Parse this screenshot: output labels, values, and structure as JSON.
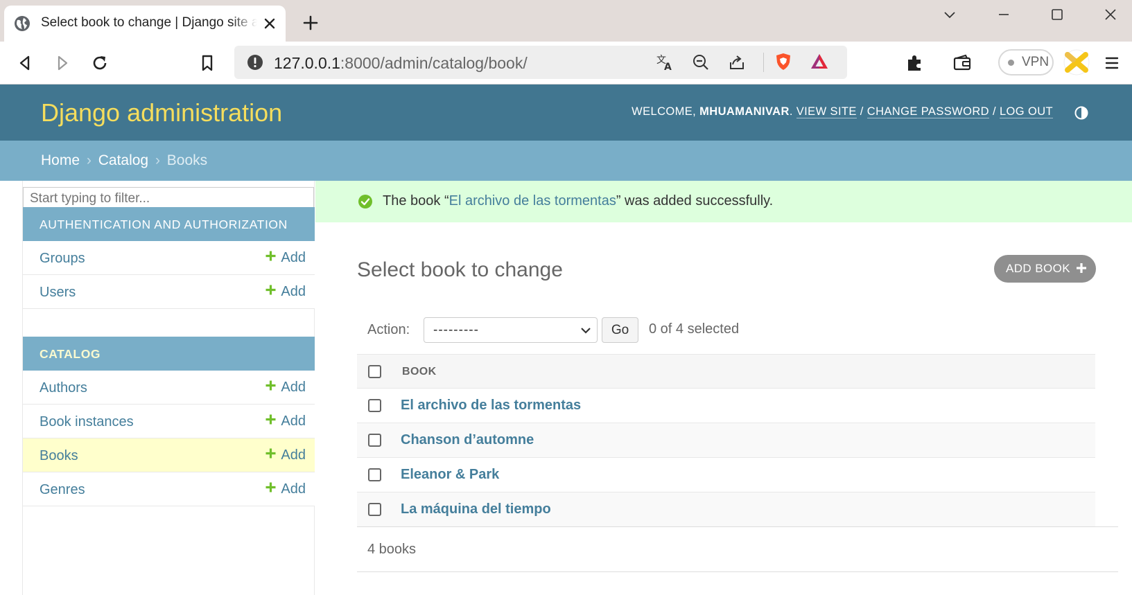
{
  "browser": {
    "tab_title": "Select book to change | Django site admin",
    "url_host": "127.0.0.1",
    "url_rest": ":8000/admin/catalog/book/",
    "vpn_label": "VPN",
    "icons": [
      "globe-icon",
      "close-icon",
      "plus-icon",
      "chevron-down-icon",
      "minimize-icon",
      "maximize-icon",
      "back-icon",
      "forward-icon",
      "reload-icon",
      "bookmark-icon",
      "info-icon",
      "translate-icon",
      "zoom-out-icon",
      "share-icon",
      "brave-shield-icon",
      "brave-rewards-icon",
      "extensions-icon",
      "wallet-icon",
      "profile-icon",
      "menu-icon"
    ]
  },
  "header": {
    "brand": "Django administration",
    "welcome": "WELCOME,",
    "username": "MHUAMANIVAR",
    "view_site": "VIEW SITE",
    "change_password": "CHANGE PASSWORD",
    "log_out": "LOG OUT",
    "separator": "/"
  },
  "breadcrumbs": {
    "home": "Home",
    "catalog": "Catalog",
    "current": "Books",
    "separator": "›"
  },
  "sidebar": {
    "filter_placeholder": "Start typing to filter...",
    "add_label": "Add",
    "modules": [
      {
        "caption": "AUTHENTICATION AND AUTHORIZATION",
        "models": [
          {
            "name": "Groups"
          },
          {
            "name": "Users"
          }
        ]
      },
      {
        "caption": "CATALOG",
        "models": [
          {
            "name": "Authors"
          },
          {
            "name": "Book instances"
          },
          {
            "name": "Books",
            "current": true
          },
          {
            "name": "Genres"
          }
        ]
      }
    ]
  },
  "message": {
    "prefix": "The book “",
    "link": "El archivo de las tormentas",
    "suffix": "” was added successfully."
  },
  "content": {
    "title": "Select book to change",
    "add_button": "ADD BOOK",
    "action_label": "Action:",
    "action_value": "---------",
    "go_label": "Go",
    "selected_count": "0 of 4 selected",
    "column_header": "BOOK",
    "books": [
      "El archivo de las tormentas",
      "Chanson d’automne",
      "Eleanor & Park",
      "La máquina del tiempo"
    ],
    "paginator": "4 books"
  },
  "colors": {
    "header_bg": "#417690",
    "brand": "#f5dd5d",
    "breadcrumb_bg": "#79aec8",
    "link": "#447e9b",
    "success_bg": "#ddffdd",
    "add_green": "#70bf2b",
    "current_row": "#ffffcc"
  }
}
